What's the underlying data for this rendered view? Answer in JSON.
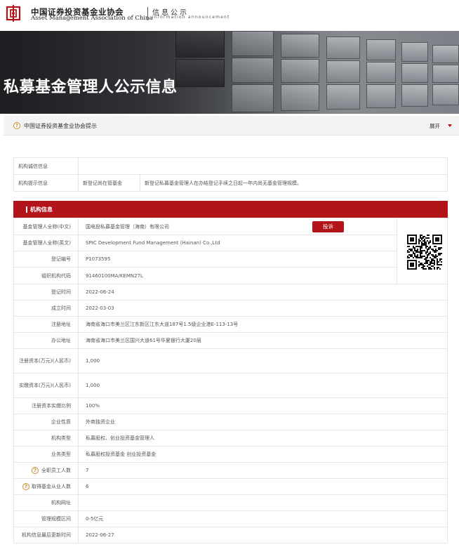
{
  "header": {
    "org_cn": "中国证券投资基金业协会",
    "org_en": "Asset Management Association of China",
    "section_cn": "信息公示",
    "section_en": "information announcement"
  },
  "banner": {
    "title": "私募基金管理人公示信息"
  },
  "notice": {
    "text": "中国证券投资基金业协会提示",
    "expand_label": "展开",
    "help_glyph": "?"
  },
  "credit": {
    "rows": [
      {
        "label": "机构诚信信息",
        "tag": "",
        "value": ""
      },
      {
        "label": "机构提示信息",
        "tag": "新登记尚在管基金",
        "value": "新登记私募基金管理人在办结登记手续之日起一年内尚无基金管理规模。"
      }
    ]
  },
  "section": {
    "title": "机构信息"
  },
  "complain_label": "投诉",
  "colors": {
    "brand_red": "#b3141a",
    "help_orange": "#c98a2a"
  },
  "info": {
    "rows": [
      {
        "label": "基金管理人全称(中文)",
        "value": "国电投私募基金管理（海南）有限公司"
      },
      {
        "label": "基金管理人全称(英文)",
        "value": "SPIC Development Fund Management (Hainan) Co.,Ltd"
      },
      {
        "label": "登记编号",
        "value": "P1073595"
      },
      {
        "label": "组织机构代码",
        "value": "91460100MA/KEMN27L"
      },
      {
        "label": "登记时间",
        "value": "2022-06-24"
      },
      {
        "label": "成立时间",
        "value": "2022-03-03"
      },
      {
        "label": "注册地址",
        "value": "海南省海口市美兰区江东新区江东大道187号1.5级企业港E-113-13号"
      },
      {
        "label": "办公地址",
        "value": "海南省海口市美兰区国兴大道61号华夏银行大厦20层"
      },
      {
        "label": "注册资本(万元)(人民币)",
        "value": "1,000"
      },
      {
        "label": "实缴资本(万元)(人民币)",
        "value": "1,000"
      },
      {
        "label": "注册资本实缴比例",
        "value": "100%"
      },
      {
        "label": "企业性质",
        "value": "外商独资企业"
      },
      {
        "label": "机构类型",
        "value": "私募股权、创业投资基金管理人"
      },
      {
        "label": "业务类型",
        "value": "私募股权投资基金  创业投资基金"
      },
      {
        "label": "全职员工人数",
        "value": "7",
        "help": true
      },
      {
        "label": "取得基金从业人数",
        "value": "6",
        "help": true
      },
      {
        "label": "机构网址",
        "value": ""
      },
      {
        "label": "管理规模区间",
        "value": "0-5亿元"
      },
      {
        "label": "机构信息最后更新时间",
        "value": "2022-06-27"
      }
    ]
  }
}
